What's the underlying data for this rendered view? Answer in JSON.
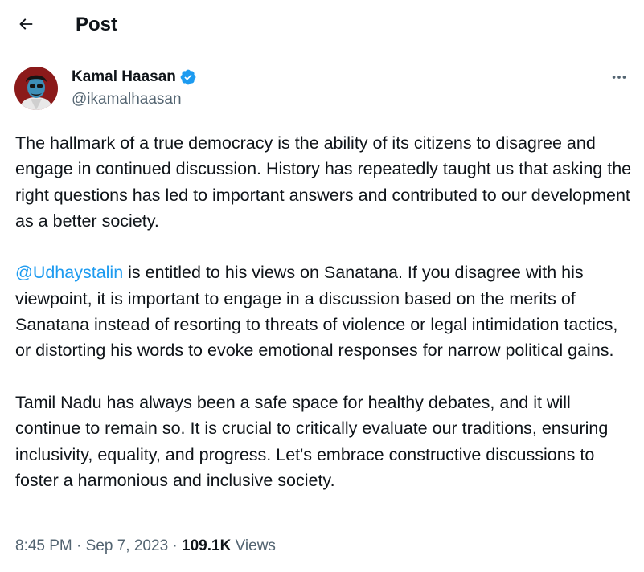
{
  "header": {
    "title": "Post",
    "back_icon": "arrow-left-icon"
  },
  "author": {
    "name": "Kamal Haasan",
    "handle": "@ikamalhaasan",
    "verified_icon": "verified-badge-icon",
    "verified_color": "#1d9bf0"
  },
  "more_icon": "more-horizontal-icon",
  "tweet": {
    "p1": "The hallmark of a true democracy is the ability of its citizens to disagree and engage in continued discussion. History has repeatedly taught us that asking the right questions has led to important answers and contributed to our development as a better society.",
    "mention": "@Udhaystalin",
    "p2_rest": " is entitled to his views on Sanatana. If you disagree with his viewpoint, it is important to engage in a discussion based on the merits of Sanatana instead of resorting to threats of violence or legal intimidation tactics, or distorting his words to evoke emotional responses for narrow political gains.",
    "p3": "Tamil Nadu has always been a safe space for healthy debates, and it will continue to remain so. It is crucial to critically evaluate our traditions, ensuring inclusivity, equality, and progress. Let's embrace constructive discussions to foster a harmonious and inclusive society."
  },
  "meta": {
    "time": "8:45 PM",
    "separator": "·",
    "date": "Sep 7, 2023",
    "views_count": "109.1K",
    "views_label": "Views"
  },
  "colors": {
    "text": "#0f1419",
    "secondary": "#536471",
    "accent": "#1d9bf0",
    "avatar_bg": "#8b1a1a"
  }
}
